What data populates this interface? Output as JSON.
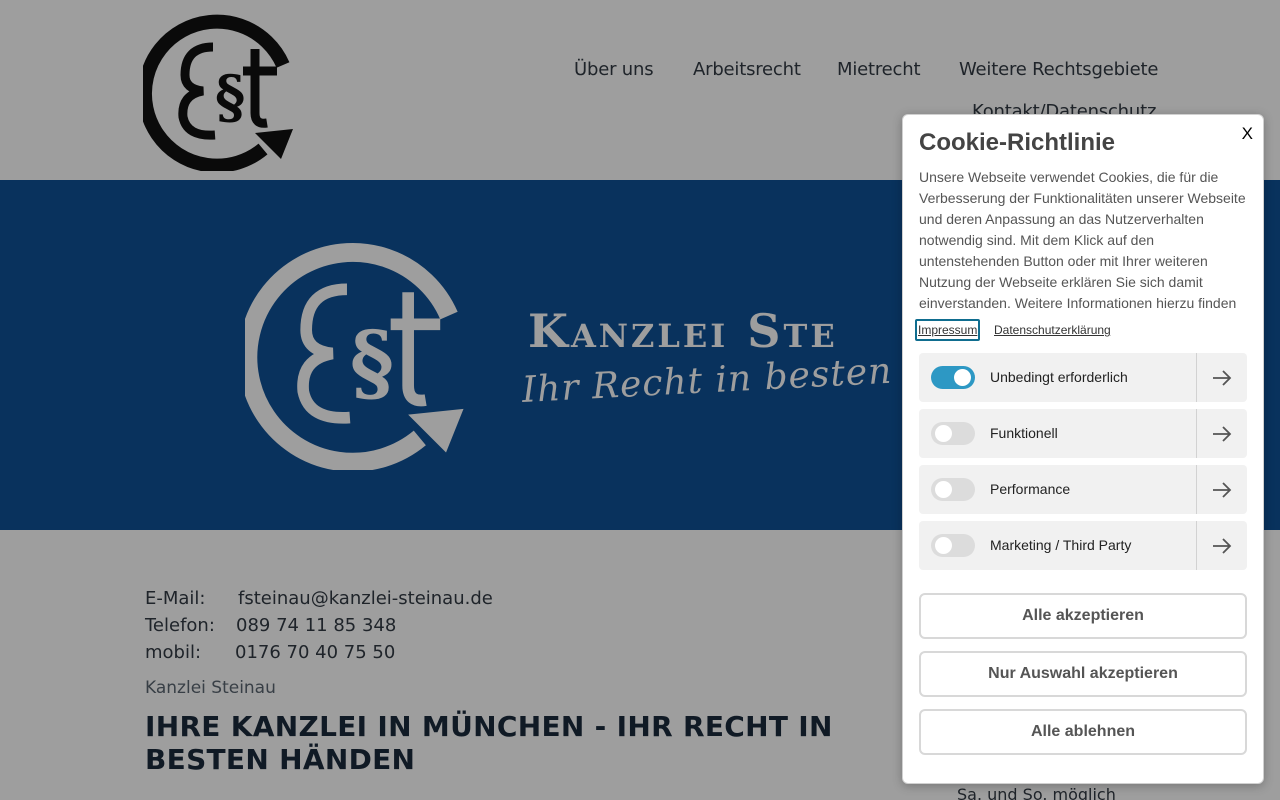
{
  "header": {
    "logo_icon": "kanzlei-steinau-logo",
    "nav": [
      {
        "label": "Über uns"
      },
      {
        "label": "Arbeitsrecht"
      },
      {
        "label": "Mietrecht"
      },
      {
        "label": "Weitere Rechtsgebiete"
      },
      {
        "label": "Kontakt/Datenschutz"
      }
    ]
  },
  "hero": {
    "background_color": "#0f5196",
    "title": "Kanzlei Ste",
    "slogan": "Ihr Recht in besten"
  },
  "contact": {
    "email_label": "E-Mail:",
    "email_value": "fsteinau@kanzlei-steinau.de",
    "phone_label": "Telefon:",
    "phone_value": "089 74 11 85 348",
    "mobile_label": "mobil:",
    "mobile_value": "0176 70 40 75 50"
  },
  "main": {
    "subtitle": "Kanzlei Steinau",
    "headline": "IHRE KANZLEI IN MÜNCHEN - IHR RECHT IN BESTEN HÄNDEN",
    "side_note": "Sa. und So. möglich"
  },
  "cookie_dialog": {
    "close_label": "X",
    "title": "Cookie-Richtlinie",
    "text": "Unsere Webseite verwendet Cookies, die für die Verbesserung der Funktionalitäten unserer Webseite und deren Anpassung an das Nutzerverhalten notwendig sind. Mit dem Klick auf den untenstehenden Button oder mit Ihrer weiteren Nutzung der Webseite erklären Sie sich damit einverstanden. Weitere Informationen hierzu finden",
    "links": [
      {
        "label": "Impressum"
      },
      {
        "label": "Datenschutzerklärung"
      }
    ],
    "categories": [
      {
        "label": "Unbedingt erforderlich",
        "enabled": true
      },
      {
        "label": "Funktionell",
        "enabled": false
      },
      {
        "label": "Performance",
        "enabled": false
      },
      {
        "label": "Marketing / Third Party",
        "enabled": false
      }
    ],
    "accent_color": "#2d98c4",
    "buttons": {
      "accept_all": "Alle akzeptieren",
      "accept_selection": "Nur Auswahl akzeptieren",
      "reject_all": "Alle ablehnen"
    }
  }
}
